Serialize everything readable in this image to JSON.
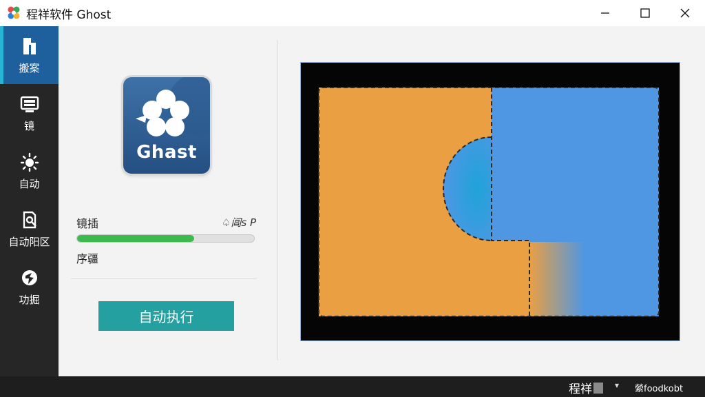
{
  "window": {
    "title": "程祥软件 Ghost",
    "controls": [
      "minimize-icon",
      "maximize-icon",
      "close-icon"
    ]
  },
  "sidebar": {
    "items": [
      {
        "label": "搬案",
        "icon": "file-icon",
        "active": true
      },
      {
        "label": "镜",
        "icon": "monitor-icon",
        "active": false
      },
      {
        "label": "自动",
        "icon": "sun-gear-icon",
        "active": false
      },
      {
        "label": "自动阳区",
        "icon": "lock-search-icon",
        "active": false
      },
      {
        "label": "功掘",
        "icon": "shield-icon",
        "active": false
      }
    ]
  },
  "main": {
    "logo_text": "Ghast",
    "progress": {
      "label": "镜插",
      "status": "♤阊s P",
      "fraction": 0.66
    },
    "sub_label": "序疆",
    "run_button": "自动执行"
  },
  "statusbar": {
    "left_text": "程祥",
    "caret": "▾",
    "right_text": "縈foodkobt"
  },
  "colors": {
    "accent": "#1e5f9e",
    "progress": "#3dba4e",
    "button": "#25a0a0",
    "preview_orange": "#ea9f43",
    "preview_blue": "#4f97e3"
  }
}
